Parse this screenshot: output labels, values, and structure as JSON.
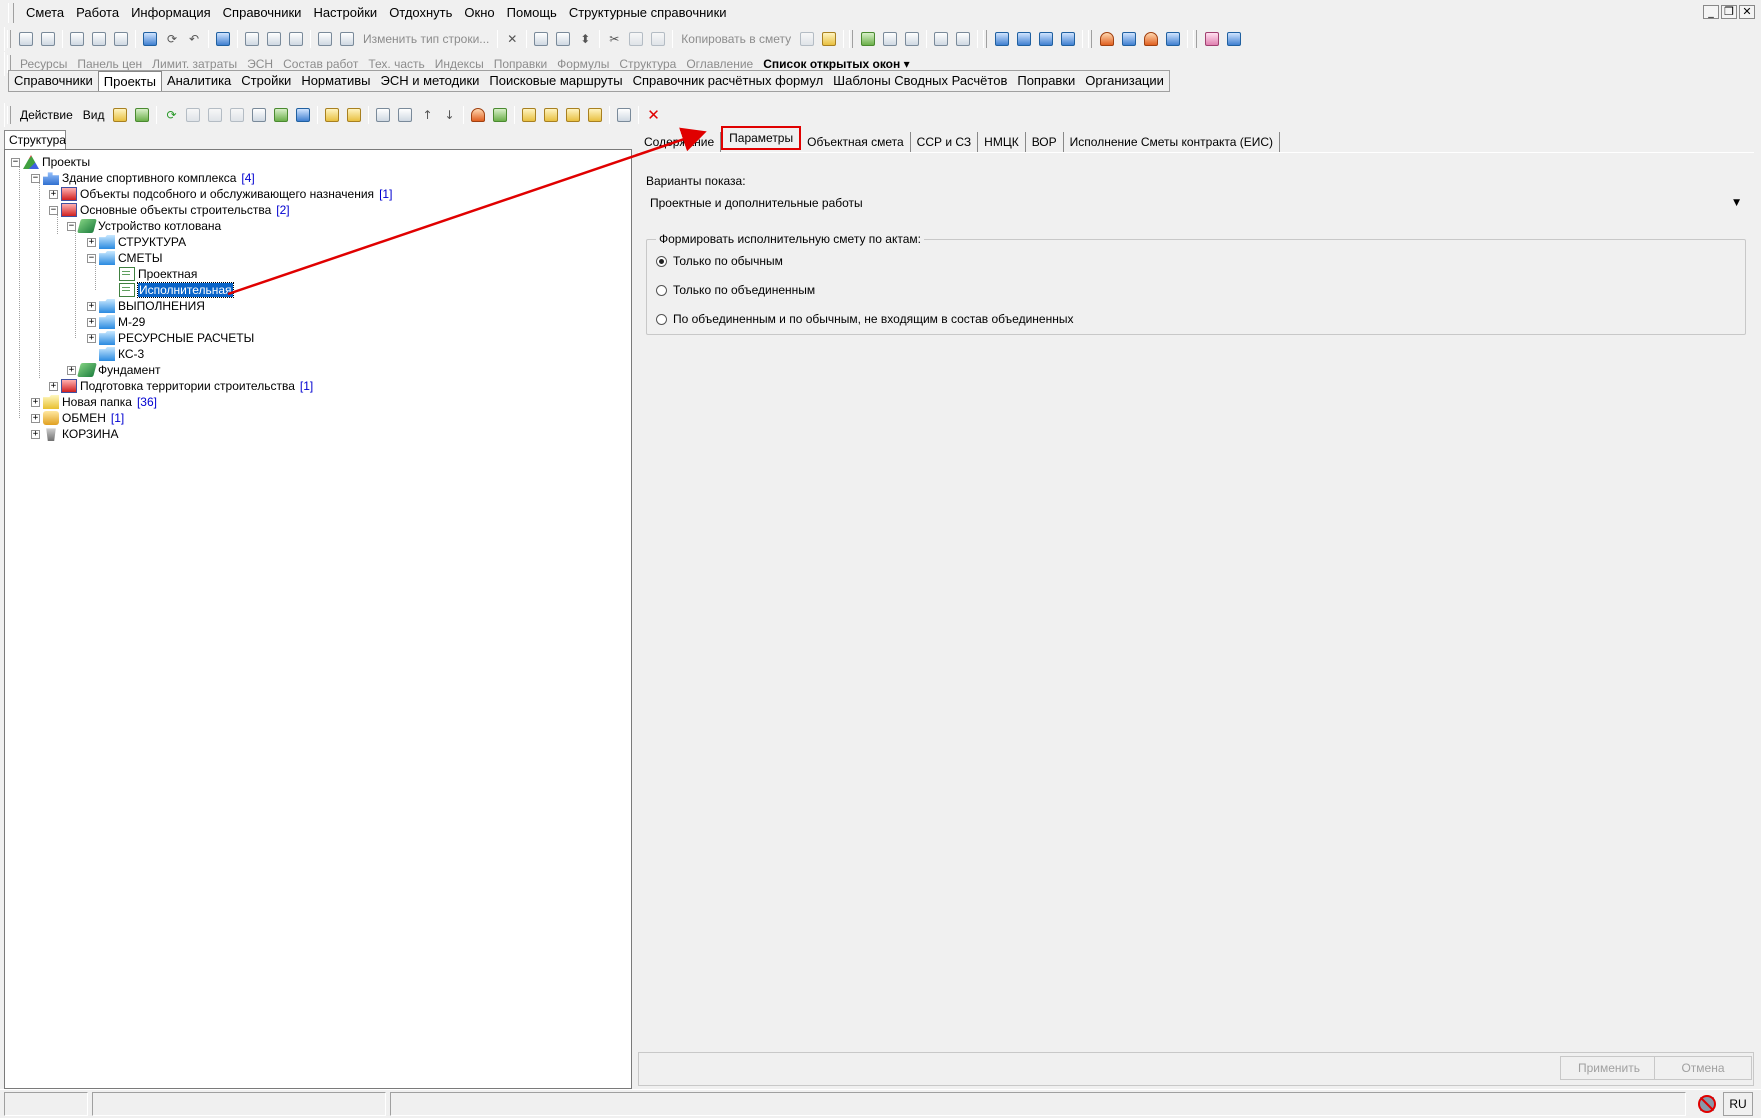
{
  "menu": [
    "Смета",
    "Работа",
    "Информация",
    "Справочники",
    "Настройки",
    "Отдохнуть",
    "Окно",
    "Помощь",
    "Структурные справочники"
  ],
  "toolbar1": {
    "change_type_label": "Изменить тип строки...",
    "copy_to_estimate_label": "Копировать в смету"
  },
  "toolbar2": [
    "Ресурсы",
    "Панель цен",
    "Лимит. затраты",
    "ЭСН",
    "Состав работ",
    "Тех. часть",
    "Индексы",
    "Поправки",
    "Формулы",
    "Структура",
    "Оглавление"
  ],
  "open_windows_label": "Список открытых окон",
  "nav_tabs": [
    "Справочники",
    "Проекты",
    "Аналитика",
    "Стройки",
    "Нормативы",
    "ЭСН и методики",
    "Поисковые маршруты",
    "Справочник расчётных формул",
    "Шаблоны Сводных Расчётов",
    "Поправки",
    "Организации"
  ],
  "nav_active": "Проекты",
  "action_toolbar": {
    "action": "Действие",
    "view": "Вид"
  },
  "left_tab": "Структура",
  "tree": {
    "root": "Проекты",
    "building": "Здание спортивного комплекса",
    "building_count": "[4]",
    "aux": "Объекты подсобного и обслуживающего назначения",
    "aux_count": "[1]",
    "main": "Основные объекты строительства",
    "main_count": "[2]",
    "pit": "Устройство котлована",
    "structure": "СТРУКТУРА",
    "estimates": "СМЕТЫ",
    "design": "Проектная",
    "executive": "Исполнительная",
    "fulfillment": "ВЫПОЛНЕНИЯ",
    "m29": "М-29",
    "resource_calc": "РЕСУРСНЫЕ РАСЧЕТЫ",
    "ks3": "КС-3",
    "foundation": "Фундамент",
    "prep": "Подготовка территории строительства",
    "prep_count": "[1]",
    "new_folder": "Новая папка",
    "new_folder_count": "[36]",
    "exchange": "ОБМЕН",
    "exchange_count": "[1]",
    "trash": "КОРЗИНА"
  },
  "right_tabs": [
    "Содержание",
    "Параметры",
    "Объектная смета",
    "ССР и СЗ",
    "НМЦК",
    "ВОР",
    "Исполнение Сметы контракта (ЕИС)"
  ],
  "right_active": "Параметры",
  "params": {
    "display_variants_label": "Варианты показа:",
    "display_variant_value": "Проектные и дополнительные работы",
    "group_label": "Формировать исполнительную смету по актам:",
    "radios": [
      "Только по обычным",
      "Только по объединенным",
      "По объединенным и по обычным, не входящим в состав объединенных"
    ],
    "selected_radio": 0
  },
  "buttons": {
    "apply": "Применить",
    "cancel": "Отмена"
  },
  "status": {
    "lang": "RU"
  },
  "colors": {
    "highlight": "#e00000",
    "selection": "#0a64c8",
    "count": "#0000d0"
  }
}
